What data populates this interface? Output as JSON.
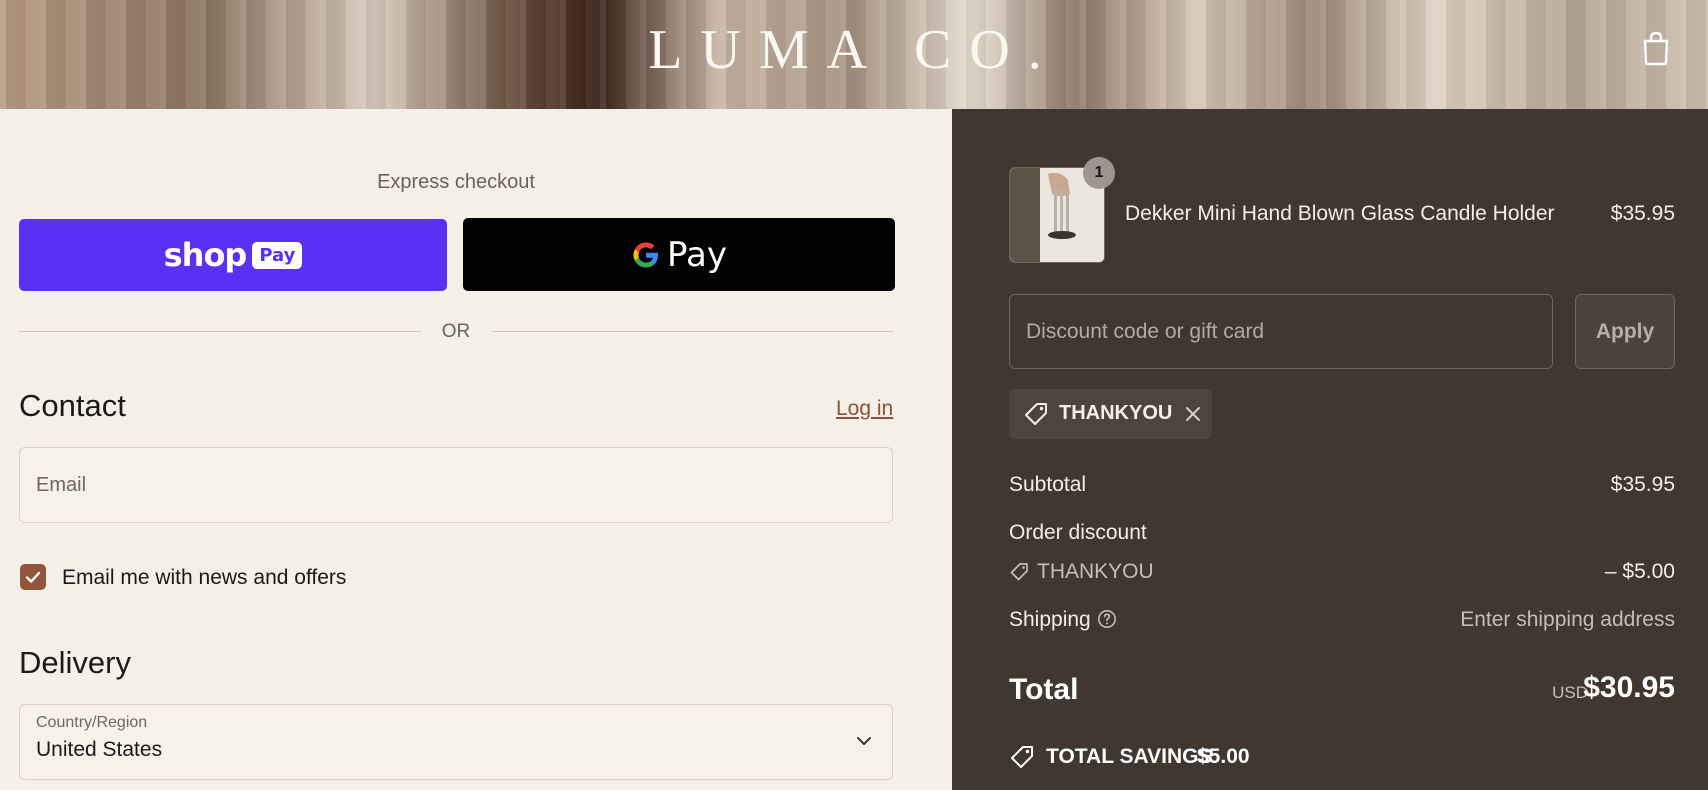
{
  "header": {
    "brand": "LUMA CO.",
    "cart_icon": "shopping-bag-icon"
  },
  "express": {
    "title": "Express checkout",
    "shop_pay_word": "shop",
    "shop_pay_badge": "Pay",
    "gpay_label": "Pay",
    "or_text": "OR"
  },
  "contact": {
    "heading": "Contact",
    "login_label": "Log in",
    "email_placeholder": "Email",
    "newsletter_label": "Email me with news and offers",
    "newsletter_checked": true
  },
  "delivery": {
    "heading": "Delivery",
    "country_label": "Country/Region",
    "country_value": "United States"
  },
  "summary": {
    "product": {
      "name": "Dekker Mini Hand Blown Glass Candle Holder",
      "price": "$35.95",
      "quantity": "1"
    },
    "discount_placeholder": "Discount code or gift card",
    "apply_label": "Apply",
    "applied_code": "THANKYOU",
    "subtotal_label": "Subtotal",
    "subtotal_value": "$35.95",
    "order_discount_label": "Order discount",
    "discount_code": "THANKYOU",
    "discount_value": "– $5.00",
    "shipping_label": "Shipping",
    "shipping_value": "Enter shipping address",
    "total_label": "Total",
    "total_currency": "USD",
    "total_value": "$30.95",
    "savings_label": "TOTAL SAVINGS",
    "savings_value": "$5.00"
  },
  "colors": {
    "shop_pay": "#5a31f4",
    "gpay": "#000000",
    "accent": "#94543a",
    "summary_bg": "#403731",
    "page_bg": "#f4f0e8"
  }
}
